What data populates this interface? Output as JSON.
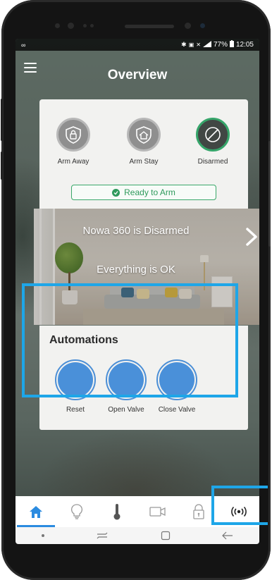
{
  "status_bar": {
    "left": "∞",
    "battery": "77%",
    "time": "12:05"
  },
  "header": {
    "title": "Overview",
    "menu_icon": "hamburger-menu-icon"
  },
  "security": {
    "modes": [
      {
        "label": "Arm Away",
        "icon": "shield-lock-icon",
        "active": false
      },
      {
        "label": "Arm Stay",
        "icon": "house-lock-icon",
        "active": false
      },
      {
        "label": "Disarmed",
        "icon": "disarmed-slash-icon",
        "active": true
      }
    ],
    "ready_status": "Ready to Arm",
    "colors": {
      "accent": "#36a56a",
      "inactive": "#8f8f8f"
    }
  },
  "room": {
    "title": "Nowa 360 is Disarmed",
    "status": "Everything is OK"
  },
  "automations": {
    "title": "Automations",
    "buttons": [
      {
        "label": "Reset"
      },
      {
        "label": "Open Valve"
      },
      {
        "label": "Close Valve"
      }
    ],
    "color": "#4a90d9"
  },
  "bottom_nav": {
    "items": [
      {
        "icon": "home-icon",
        "active": true
      },
      {
        "icon": "lightbulb-icon",
        "active": false
      },
      {
        "icon": "thermometer-icon",
        "active": false
      },
      {
        "icon": "video-camera-icon",
        "active": false
      },
      {
        "icon": "lock-icon",
        "active": false
      },
      {
        "icon": "wireless-signal-icon",
        "active": false
      }
    ],
    "highlight_color": "#1ea6e8"
  },
  "soft_keys": [
    "dot-icon",
    "recent-apps-icon",
    "home-square-icon",
    "back-arrow-icon"
  ]
}
